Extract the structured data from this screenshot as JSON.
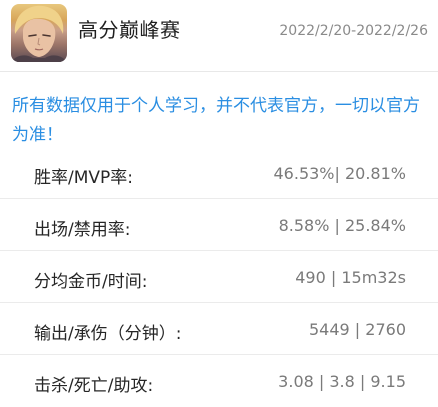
{
  "header": {
    "hero_name": "高分巅峰赛",
    "date_range": "2022/2/20-2022/2/26"
  },
  "notice": "所有数据仅用于个人学习，并不代表官方，一切以官方为准！",
  "stats": [
    {
      "label": "胜率/MVP率:",
      "value": "46.53%| 20.81%"
    },
    {
      "label": "出场/禁用率:",
      "value": "8.58% | 25.84%"
    },
    {
      "label": "分均金币/时间:",
      "value": "490 | 15m32s"
    },
    {
      "label": "输出/承伤（分钟）:",
      "value": "5449 | 2760"
    },
    {
      "label": "击杀/死亡/助攻:",
      "value": "3.08 | 3.8 | 9.15"
    }
  ],
  "colors": {
    "notice": "#2a8ee2",
    "label": "#262626",
    "value": "#7a7a7a",
    "date": "#8a8a8a"
  }
}
